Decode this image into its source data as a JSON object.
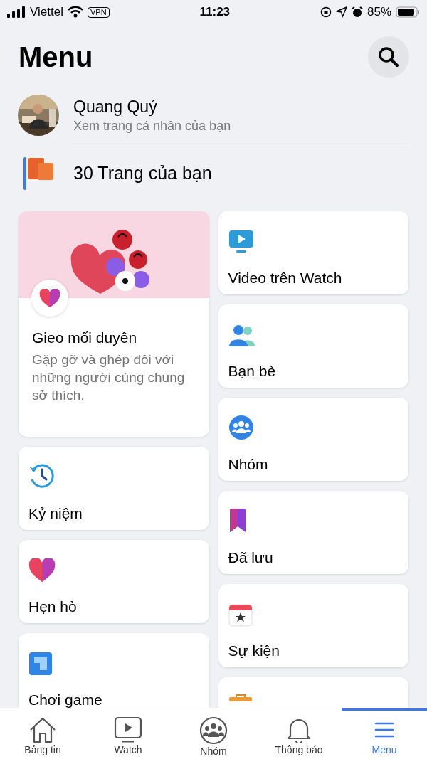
{
  "status_bar": {
    "carrier": "Viettel",
    "vpn": "VPN",
    "time": "11:23",
    "battery": "85%"
  },
  "header": {
    "title": "Menu"
  },
  "profile": {
    "name": "Quang Quý",
    "subtitle": "Xem trang cá nhân của bạn"
  },
  "pages": {
    "label": "30 Trang của bạn"
  },
  "left_cards": [
    {
      "kind": "featured",
      "title": "Gieo mối duyên",
      "description": "Gặp gỡ và ghép đôi với những người cùng chung sở thích."
    },
    {
      "kind": "memories",
      "title": "Kỷ niệm"
    },
    {
      "kind": "dating",
      "title": "Hẹn hò"
    },
    {
      "kind": "gaming",
      "title": "Chơi game"
    }
  ],
  "right_cards": [
    {
      "kind": "video",
      "title": "Video trên Watch"
    },
    {
      "kind": "friends",
      "title": "Bạn bè"
    },
    {
      "kind": "groups",
      "title": "Nhóm"
    },
    {
      "kind": "saved",
      "title": "Đã lưu"
    },
    {
      "kind": "events",
      "title": "Sự kiện"
    },
    {
      "kind": "bag"
    }
  ],
  "tab_bar": [
    {
      "kind": "home",
      "label": "Bảng tin",
      "selected": false
    },
    {
      "kind": "watch",
      "label": "Watch",
      "selected": false
    },
    {
      "kind": "groups",
      "label": "Nhóm",
      "selected": false
    },
    {
      "kind": "bell",
      "label": "Thông báo",
      "selected": false
    },
    {
      "kind": "menu",
      "label": "Menu",
      "selected": true
    }
  ]
}
